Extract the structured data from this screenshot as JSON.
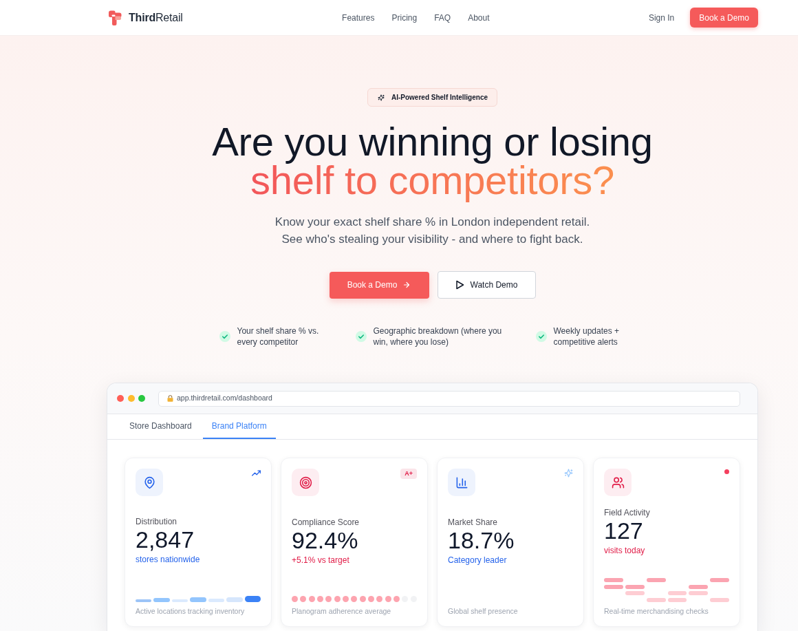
{
  "header": {
    "logo": "**Third**Retail",
    "nav": [
      "Features",
      "Pricing",
      "FAQ",
      "About"
    ],
    "sign_in": "Sign In",
    "cta": "Book a Demo"
  },
  "hero": {
    "badge": "AI-Powered Shelf Intelligence",
    "headline": "Are you winning or losing",
    "headline_accent": "shelf to competitors?",
    "subtitle": [
      "Know your exact shelf share % in London independent retail.",
      "See who's stealing your visibility - and where to fight back."
    ],
    "buttons": [
      {
        "label": "Book a Demo",
        "kind": "primary"
      },
      {
        "label": "Watch Demo",
        "kind": "video"
      }
    ],
    "features": [
      "Your shelf share % vs. every competitor",
      "Geographic breakdown (where you win, where you lose)",
      "Weekly updates + competitive alerts"
    ]
  },
  "dashboard": {
    "url": "app.thirdretail.com/dashboard",
    "tabs": [
      {
        "label": "Store Dashboard",
        "selected": false
      },
      {
        "label": "Brand Platform",
        "selected": true
      }
    ],
    "cards": [
      {
        "kind": "distribution",
        "label": "Distribution",
        "value": "2,847",
        "note": "stores nationwide",
        "color": "#2563eb",
        "footer": "Active locations tracking inventory"
      },
      {
        "kind": "compliance",
        "badge": "A+",
        "label": "Compliance Score",
        "value": "92.4%",
        "note": "+5.1% vs target",
        "color": "#e11d48",
        "level": 0.87,
        "footer": "Planogram adherence average"
      },
      {
        "kind": "share",
        "label": "Market Share",
        "value": "18.7%",
        "note": "Category leader",
        "color": "#2563eb",
        "footer": "Global shelf presence"
      },
      {
        "kind": "activity",
        "label": "Field Activity",
        "value": "127",
        "note": "visits today",
        "color": "#e11d48",
        "footer": "Real-time merchandising checks"
      }
    ]
  }
}
